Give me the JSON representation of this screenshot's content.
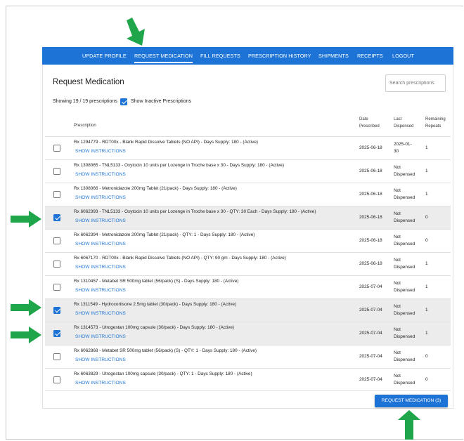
{
  "nav": {
    "items": [
      {
        "label": "UPDATE PROFILE"
      },
      {
        "label": "REQUEST MEDICATION"
      },
      {
        "label": "FILL REQUESTS"
      },
      {
        "label": "PRESCRIPTION HISTORY"
      },
      {
        "label": "SHIPMENTS"
      },
      {
        "label": "RECEIPTS"
      },
      {
        "label": "LOGOUT"
      }
    ],
    "active": "REQUEST MEDICATION"
  },
  "page": {
    "title": "Request Medication",
    "search_placeholder": "Search prescriptions",
    "showing": "Showing 19 / 19 prescriptions",
    "show_inactive_label": "Show Inactive Prescriptions",
    "show_inactive_checked": true
  },
  "table": {
    "headers": {
      "prescription": "Prescription",
      "date_prescribed": [
        "Date",
        "Prescribed"
      ],
      "last_dispensed": [
        "Last",
        "Dispensed"
      ],
      "remaining_repeats": [
        "Remaining",
        "Repeats"
      ]
    },
    "instructions_label": "SHOW INSTRUCTIONS",
    "rows": [
      {
        "rx": "Rx 1294779 - RDT00x - Blank Rapid Dissolve Tablets (NO API) - Days Supply: 180 - (Active)",
        "date": "2025-06-18",
        "dispensed": [
          "2025-01-",
          "30"
        ],
        "repeats": "1",
        "checked": false
      },
      {
        "rx": "Rx 1308065 - TNL5133 - Oxytocin 10 units per Lozenge in Troche base x 30 - Days Supply: 180 - (Active)",
        "date": "2025-06-18",
        "dispensed": [
          "Not",
          "Dispensed"
        ],
        "repeats": "1",
        "checked": false
      },
      {
        "rx": "Rx 1308066 - Metronidazole 200mg Tablet (21/pack) - Days Supply: 180 - (Active)",
        "date": "2025-06-18",
        "dispensed": [
          "Not",
          "Dispensed"
        ],
        "repeats": "1",
        "checked": false
      },
      {
        "rx": "Rx 6062393 - TNL5133 - Oxytocin 10 units per Lozenge in Troche base x 30 - QTY: 30 Each - Days Supply: 180 - (Active)",
        "date": "2025-06-18",
        "dispensed": [
          "Not",
          "Dispensed"
        ],
        "repeats": "0",
        "checked": true
      },
      {
        "rx": "Rx 6062394 - Metronidazole 200mg Tablet (21/pack) - QTY: 1 - Days Supply: 180 - (Active)",
        "date": "2025-06-18",
        "dispensed": [
          "Not",
          "Dispensed"
        ],
        "repeats": "0",
        "checked": false
      },
      {
        "rx": "Rx 6067170 - RDT00x - Blank Rapid Dissolve Tablets (NO API) - QTY: 90 gm - Days Supply: 180 - (Active)",
        "date": "2025-06-18",
        "dispensed": [
          "Not",
          "Dispensed"
        ],
        "repeats": "1",
        "checked": false
      },
      {
        "rx": "Rx 1310457 - Metabet SR 500mg tablet (56/pack) (S) - Days Supply: 180 - (Active)",
        "date": "2025-07-04",
        "dispensed": [
          "Not",
          "Dispensed"
        ],
        "repeats": "1",
        "checked": false
      },
      {
        "rx": "Rx 1311549 - Hydrocortisone 2.5mg tablet (30/pack) - Days Supply: 180 - (Active)",
        "date": "2025-07-04",
        "dispensed": [
          "Not",
          "Dispensed"
        ],
        "repeats": "1",
        "checked": true
      },
      {
        "rx": "Rx 1314573 - Utrogestan 100mg capsule (30/pack) - Days Supply: 180 - (Active)",
        "date": "2025-07-04",
        "dispensed": [
          "Not",
          "Dispensed"
        ],
        "repeats": "1",
        "checked": true
      },
      {
        "rx": "Rx 6062868 - Metabet SR 500mg tablet (56/pack) (S) - QTY: 1 - Days Supply: 180 - (Active)",
        "date": "2025-07-04",
        "dispensed": [
          "Not",
          "Dispensed"
        ],
        "repeats": "0",
        "checked": false
      },
      {
        "rx": "Rx 6063829 - Utrogestan 100mg capsule (30/pack) - QTY: 1 - Days Supply: 180 - (Active)",
        "date": "2025-07-04",
        "dispensed": [
          "Not",
          "Dispensed"
        ],
        "repeats": "0",
        "checked": false
      }
    ]
  },
  "submit_label": "REQUEST MEDICATION (3)",
  "colors": {
    "accent": "#1e74d6",
    "arrow": "#1fa64a",
    "selected_row": "#ececec"
  },
  "annotations": {
    "arrow_icon": "green-arrow-icon"
  }
}
